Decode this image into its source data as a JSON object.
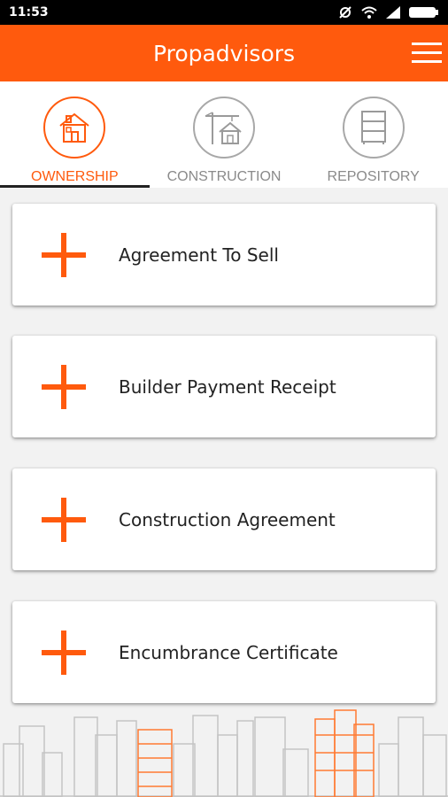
{
  "status_bar": {
    "time": "11:53",
    "icons": [
      "sync-off-icon",
      "wifi-icon",
      "signal-icon",
      "battery-icon"
    ]
  },
  "app_bar": {
    "title": "Propadvisors",
    "menu_icon": "hamburger-menu-icon"
  },
  "tabs": [
    {
      "label": "OWNERSHIP",
      "icon": "house-icon",
      "active": true
    },
    {
      "label": "CONSTRUCTION",
      "icon": "crane-house-icon",
      "active": false
    },
    {
      "label": "REPOSITORY",
      "icon": "cabinet-icon",
      "active": false
    }
  ],
  "cards": [
    {
      "label": "Agreement To Sell",
      "icon": "plus-icon"
    },
    {
      "label": "Builder Payment Receipt",
      "icon": "plus-icon"
    },
    {
      "label": "Construction Agreement",
      "icon": "plus-icon"
    },
    {
      "label": "Encumbrance Certificate",
      "icon": "plus-icon"
    }
  ],
  "colors": {
    "brand": "#ff5a0d",
    "tab_inactive": "#8a8a8a",
    "background": "#f2f2f2"
  },
  "footer": {
    "decoration": "city-skyline-illustration"
  }
}
